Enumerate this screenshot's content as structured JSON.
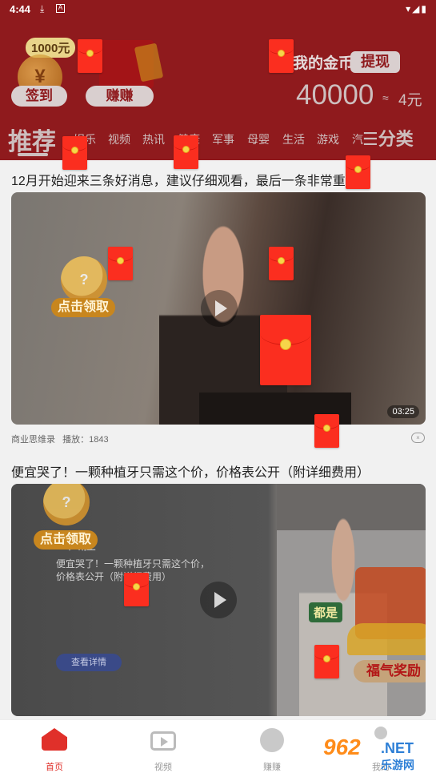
{
  "status_bar": {
    "time": "4:44"
  },
  "header": {
    "coin_tag": "1000元",
    "signin_label": "签到",
    "earn_label": "赚赚",
    "my_coins_label": "我的金币",
    "withdraw_label": "提现",
    "coin_amount": "40000",
    "approx": "≈",
    "rmb_amount": "4元"
  },
  "tabs": {
    "active": "推荐",
    "items": [
      "娱乐",
      "视频",
      "热讯",
      "健康",
      "军事",
      "母婴",
      "生活",
      "游戏",
      "汽"
    ],
    "categories_label": "分类"
  },
  "feed": {
    "articles": [
      {
        "title": "12月开始迎来三条好消息，建议仔细观看，最后一条非常重要",
        "duration": "03:25",
        "source": "商业思维录",
        "plays": "播放：1843",
        "promo_label": "点击领取",
        "promo_coin": "?"
      },
      {
        "title": "便宜哭了！一颗种植牙只需这个价，价格表公开（附详细费用）",
        "ad_heading": "口腔",
        "ad_text": "便宜哭了！一颗种植牙只需这个价，价格表公开（附详细费用）",
        "ad_button": "查看详情",
        "green_tag": "都是",
        "fortune_label": "福气奖励",
        "promo_label": "点击领取",
        "promo_coin": "?"
      }
    ]
  },
  "bottom_nav": [
    {
      "label": "首页",
      "icon": "home-icon",
      "active": true
    },
    {
      "label": "视频",
      "icon": "video-icon",
      "active": false
    },
    {
      "label": "赚赚",
      "icon": "earn-icon",
      "active": false
    },
    {
      "label": "我的",
      "icon": "me-icon",
      "active": false
    }
  ],
  "watermark": {
    "brand": "962",
    "suffix": ".NET",
    "site": "乐游网"
  },
  "colors": {
    "header_red": "#8f1a1d",
    "envelope_red": "#fb2e1f",
    "accent": "#e0302a"
  }
}
